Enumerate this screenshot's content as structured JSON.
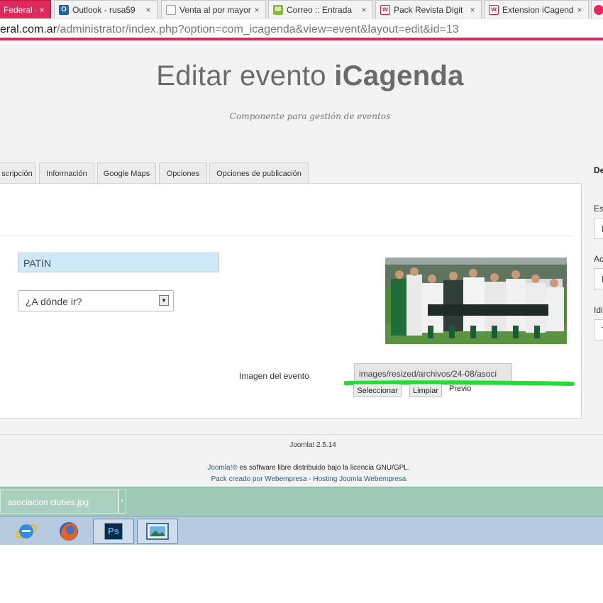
{
  "browser": {
    "tabs": [
      {
        "title": "Federal -",
        "active": true
      },
      {
        "title": "Outlook - rusa59",
        "active": false
      },
      {
        "title": "Venta al por mayor",
        "active": false
      },
      {
        "title": "Correo :: Entrada",
        "active": false
      },
      {
        "title": "Pack Revista Digit",
        "active": false
      },
      {
        "title": "Extension iCagend",
        "active": false
      }
    ],
    "tab_close_glyph": "×",
    "url_domain": "eral.com.ar",
    "url_path": "/administrator/index.php?option=com_icagenda&view=event&layout=edit&id=13"
  },
  "page": {
    "title_prefix": "Editar evento ",
    "title_brand": "iCagenda",
    "subtitle": "Componente para gestión de eventos"
  },
  "tabs": [
    "scripción",
    "Información",
    "Google Maps",
    "Opciones",
    "Opciones de publicación"
  ],
  "form": {
    "title_value": "PATIN",
    "place_select": "¿A dónde ir?",
    "image_label": "Imagen del evento",
    "image_path": "images/resized/archivos/24-08/asoci",
    "select_button": "Seleccionar",
    "clear_button": "Limpiar",
    "preview_label": "Previo"
  },
  "sidebar": {
    "heading": "De",
    "labels": [
      "Es",
      "Ac",
      "Idi"
    ],
    "field_values": [
      "F",
      "F",
      "T"
    ]
  },
  "footer": {
    "version": "Joomla! 2.5.14",
    "license_link": "Joomla!®",
    "license_text": " es software libre distribuido bajo la licencia GNU/GPL.",
    "credit": "Pack creado por Webempresa - Hosting Joomla Webempresa"
  },
  "downloads": {
    "file": "asociacion clubes.jpg",
    "menu_glyph": "▾"
  },
  "taskbar": {
    "apps": [
      "internet-explorer-icon",
      "firefox-icon",
      "photoshop-icon",
      "photo-viewer-icon"
    ],
    "ps_label": "Ps"
  },
  "colors": {
    "accent": "#e0285a",
    "input_highlight": "#cfe9f7",
    "annotation_green": "#22dd33",
    "download_bar": "#9fc9b7",
    "taskbar": "#b7cbe0"
  }
}
